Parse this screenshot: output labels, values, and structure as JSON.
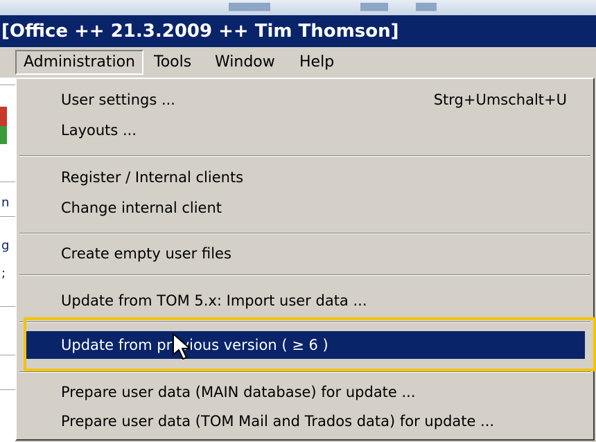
{
  "window": {
    "title": "[Office ++ 21.3.2009 ++ Tim Thomson]"
  },
  "menubar": {
    "items": [
      {
        "label": "Administration",
        "open": true
      },
      {
        "label": "Tools"
      },
      {
        "label": "Window"
      },
      {
        "label": "Help"
      }
    ]
  },
  "administration_menu": {
    "items": [
      {
        "label": "User settings ...",
        "shortcut": "Strg+Umschalt+U"
      },
      {
        "label": "Layouts ..."
      },
      {
        "label": "Register / Internal clients"
      },
      {
        "label": "Change internal client"
      },
      {
        "label": "Create empty user files"
      },
      {
        "label": "Update from TOM 5.x: Import user data  ..."
      },
      {
        "label": "Update from previous version (  ≥ 6 )",
        "highlighted": true
      },
      {
        "label": "Prepare user data (MAIN database) for update ..."
      },
      {
        "label": "Prepare user data (TOM Mail and Trados data)  for update ..."
      }
    ]
  },
  "colors": {
    "title_bar": "#0a246a",
    "menu_bg": "#d4d0c8",
    "highlight": "#0a246a",
    "annotation_frame": "#f2c40f"
  },
  "icons": {
    "cursor": "mouse-pointer-icon"
  }
}
